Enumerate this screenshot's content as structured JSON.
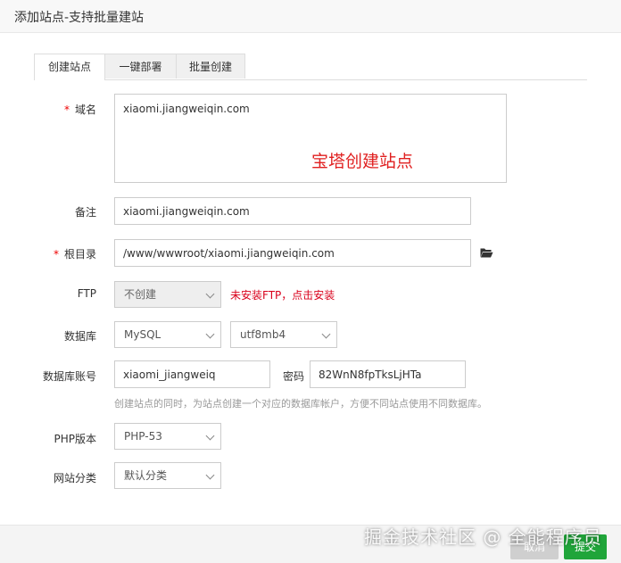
{
  "dialog": {
    "title": "添加站点-支持批量建站"
  },
  "tabs": [
    {
      "label": "创建站点"
    },
    {
      "label": "一键部署"
    },
    {
      "label": "批量创建"
    }
  ],
  "form": {
    "domain": {
      "label": "域名",
      "value": "xiaomi.jiangweiqin.com",
      "overlay_text": "宝塔创建站点"
    },
    "remark": {
      "label": "备注",
      "value": "xiaomi.jiangweiqin.com"
    },
    "root_dir": {
      "label": "根目录",
      "value": "/www/wwwroot/xiaomi.jiangweiqin.com",
      "icon": "folder-open-icon"
    },
    "ftp": {
      "label": "FTP",
      "value": "不创建",
      "warning": "未安装FTP，点击安装"
    },
    "database": {
      "label": "数据库",
      "type_value": "MySQL",
      "charset_value": "utf8mb4"
    },
    "db_account": {
      "label": "数据库账号",
      "value": "xiaomi_jiangweiq",
      "password_label": "密码",
      "password_value": "82WnN8fpTksLjHTa"
    },
    "db_hint": "创建站点的同时，为站点创建一个对应的数据库帐户，方便不同站点使用不同数据库。",
    "php_version": {
      "label": "PHP版本",
      "value": "PHP-53"
    },
    "site_category": {
      "label": "网站分类",
      "value": "默认分类"
    }
  },
  "footer": {
    "cancel_label": "取消",
    "submit_label": "提交"
  },
  "watermark": "掘金技术社区 @ 全能程序员",
  "colors": {
    "accent_green": "#20a53a",
    "required_red": "#e00000",
    "warning_red": "#d9001b"
  }
}
